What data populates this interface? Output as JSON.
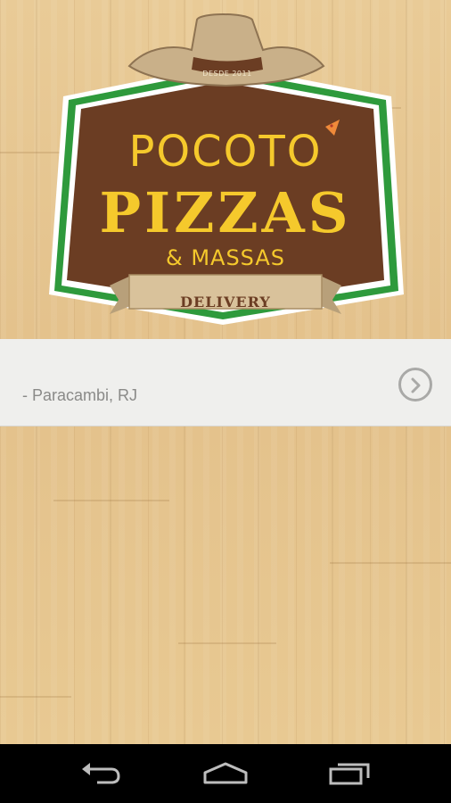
{
  "logo": {
    "brand_line1": "POCOTO",
    "brand_line2": "PIZZAS",
    "brand_line3": "& MASSAS",
    "ribbon_text": "DELIVERY",
    "hat_band_text": "DESDE 2011",
    "colors": {
      "brown": "#6b3d23",
      "green": "#2e9a3c",
      "yellow": "#f5c92c",
      "ribbon": "#d9c29b",
      "hat": "#c9b089"
    }
  },
  "store_list": {
    "items": [
      {
        "label": "- Paracambi, RJ",
        "action_icon": "chevron-right-circle-icon"
      }
    ]
  },
  "navigation_bar": {
    "buttons": [
      {
        "icon": "back-icon"
      },
      {
        "icon": "home-icon"
      },
      {
        "icon": "recent-apps-icon"
      }
    ]
  }
}
